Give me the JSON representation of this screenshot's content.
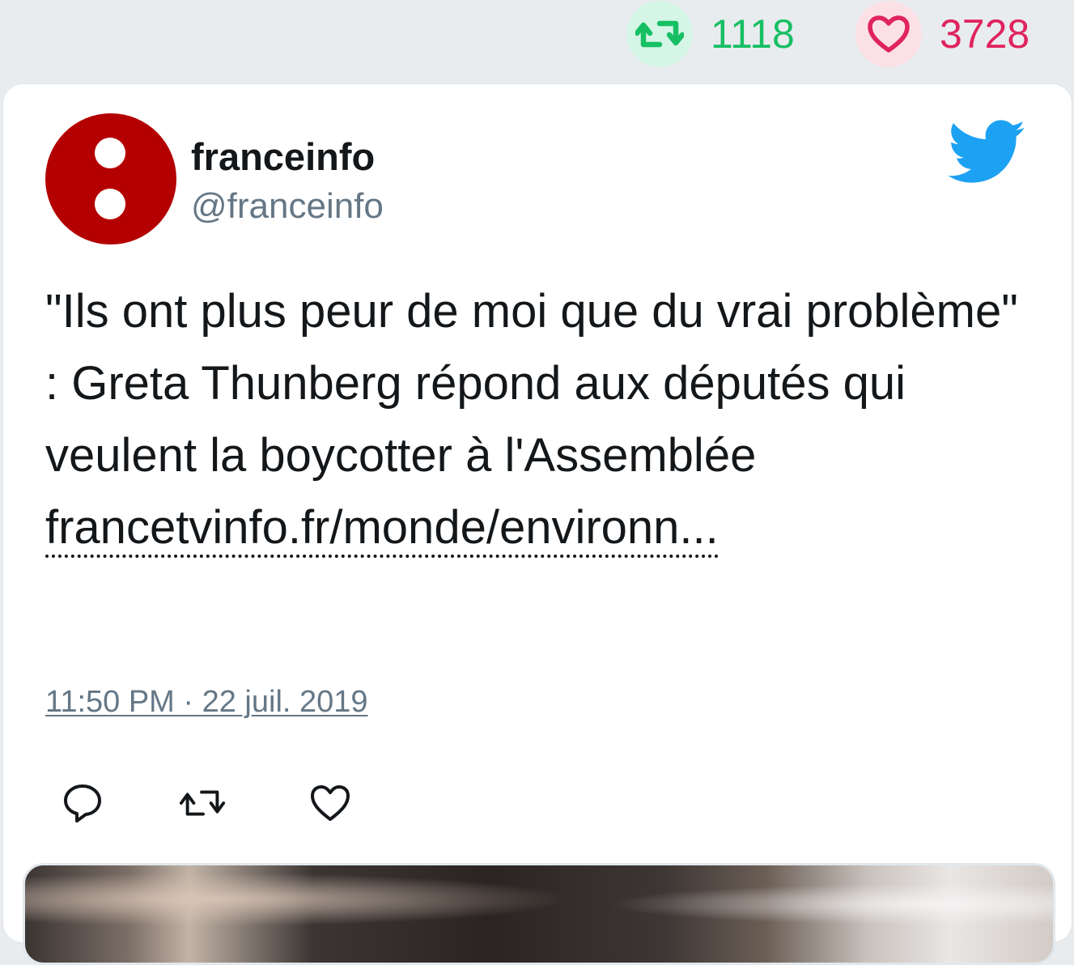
{
  "stats": {
    "retweet_count": "1118",
    "like_count": "3728",
    "retweet_icon": "retweet-icon",
    "like_icon": "heart-icon"
  },
  "tweet": {
    "user_name": "franceinfo",
    "user_handle": "@franceinfo",
    "text": "\"Ils ont plus peur de moi que du vrai problème\" : Greta Thunberg répond aux députés qui veulent la boycotter à l'Assemblée",
    "link_text": "francetvinfo.fr/monde/environn...",
    "timestamp": "11:50 PM · 22 juil. 2019",
    "brand_icon": "twitter-bird-icon",
    "actions": {
      "reply_icon": "reply-icon",
      "retweet_icon": "retweet-icon",
      "like_icon": "heart-icon"
    }
  },
  "colors": {
    "retweet_green": "#17bf63",
    "like_red": "#e0245e",
    "twitter_blue": "#1da1f2",
    "avatar_red": "#b40000",
    "secondary_text": "#657786"
  }
}
